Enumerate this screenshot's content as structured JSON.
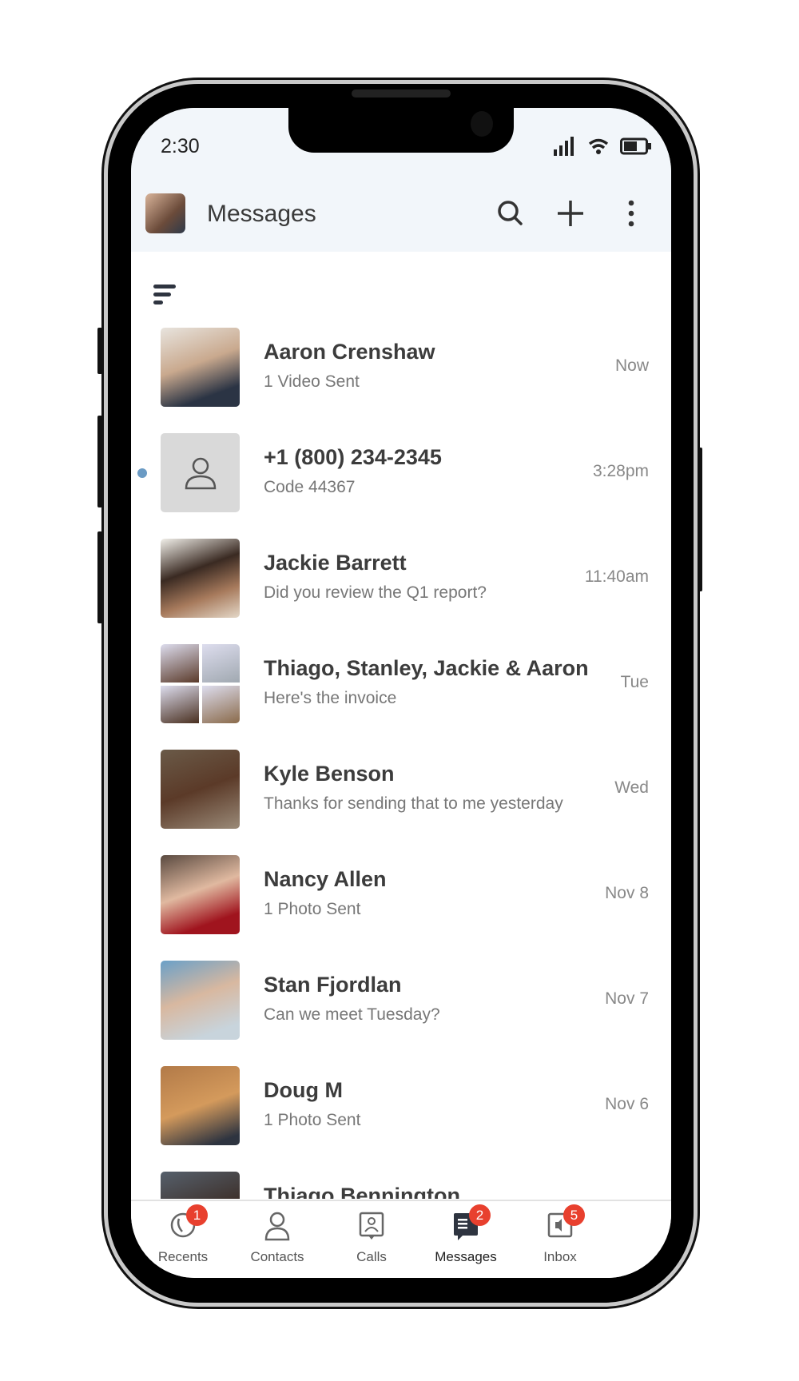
{
  "status_bar": {
    "time": "2:30"
  },
  "header": {
    "title": "Messages"
  },
  "colors": {
    "unread_dot": "#6b9bc4",
    "badge": "#e8402e",
    "header_bg": "#f2f6fa"
  },
  "conversations": [
    {
      "name": "Aaron Crenshaw",
      "preview": "1 Video Sent",
      "date": "Now",
      "unread": false,
      "avatar": "photo"
    },
    {
      "name": "+1 (800) 234-2345",
      "preview": "Code 44367",
      "date": "3:28pm",
      "unread": true,
      "avatar": "person-placeholder-icon"
    },
    {
      "name": "Jackie Barrett",
      "preview": "Did you review the Q1 report?",
      "date": "11:40am",
      "unread": false,
      "avatar": "photo"
    },
    {
      "name": "Thiago, Stanley, Jackie & Aaron",
      "preview": "Here's the invoice",
      "date": "Tue",
      "unread": false,
      "avatar": "group-photo"
    },
    {
      "name": "Kyle Benson",
      "preview": "Thanks for sending that to me yesterday",
      "date": "Wed",
      "unread": false,
      "avatar": "photo"
    },
    {
      "name": "Nancy Allen",
      "preview": "1 Photo Sent",
      "date": "Nov 8",
      "unread": false,
      "avatar": "photo"
    },
    {
      "name": "Stan Fjordlan",
      "preview": "Can we meet Tuesday?",
      "date": "Nov 7",
      "unread": false,
      "avatar": "photo"
    },
    {
      "name": "Doug M",
      "preview": "1 Photo Sent",
      "date": "Nov 6",
      "unread": false,
      "avatar": "photo"
    },
    {
      "name": "Thiago Bennington",
      "preview": "",
      "date": "",
      "unread": false,
      "avatar": "photo"
    }
  ],
  "tabs": [
    {
      "label": "Recents",
      "badge": "1",
      "icon": "recents-icon"
    },
    {
      "label": "Contacts",
      "badge": "",
      "icon": "contacts-icon"
    },
    {
      "label": "Calls",
      "badge": "",
      "icon": "calls-icon"
    },
    {
      "label": "Messages",
      "badge": "2",
      "icon": "messages-icon",
      "active": true
    },
    {
      "label": "Inbox",
      "badge": "5",
      "icon": "inbox-icon"
    }
  ]
}
